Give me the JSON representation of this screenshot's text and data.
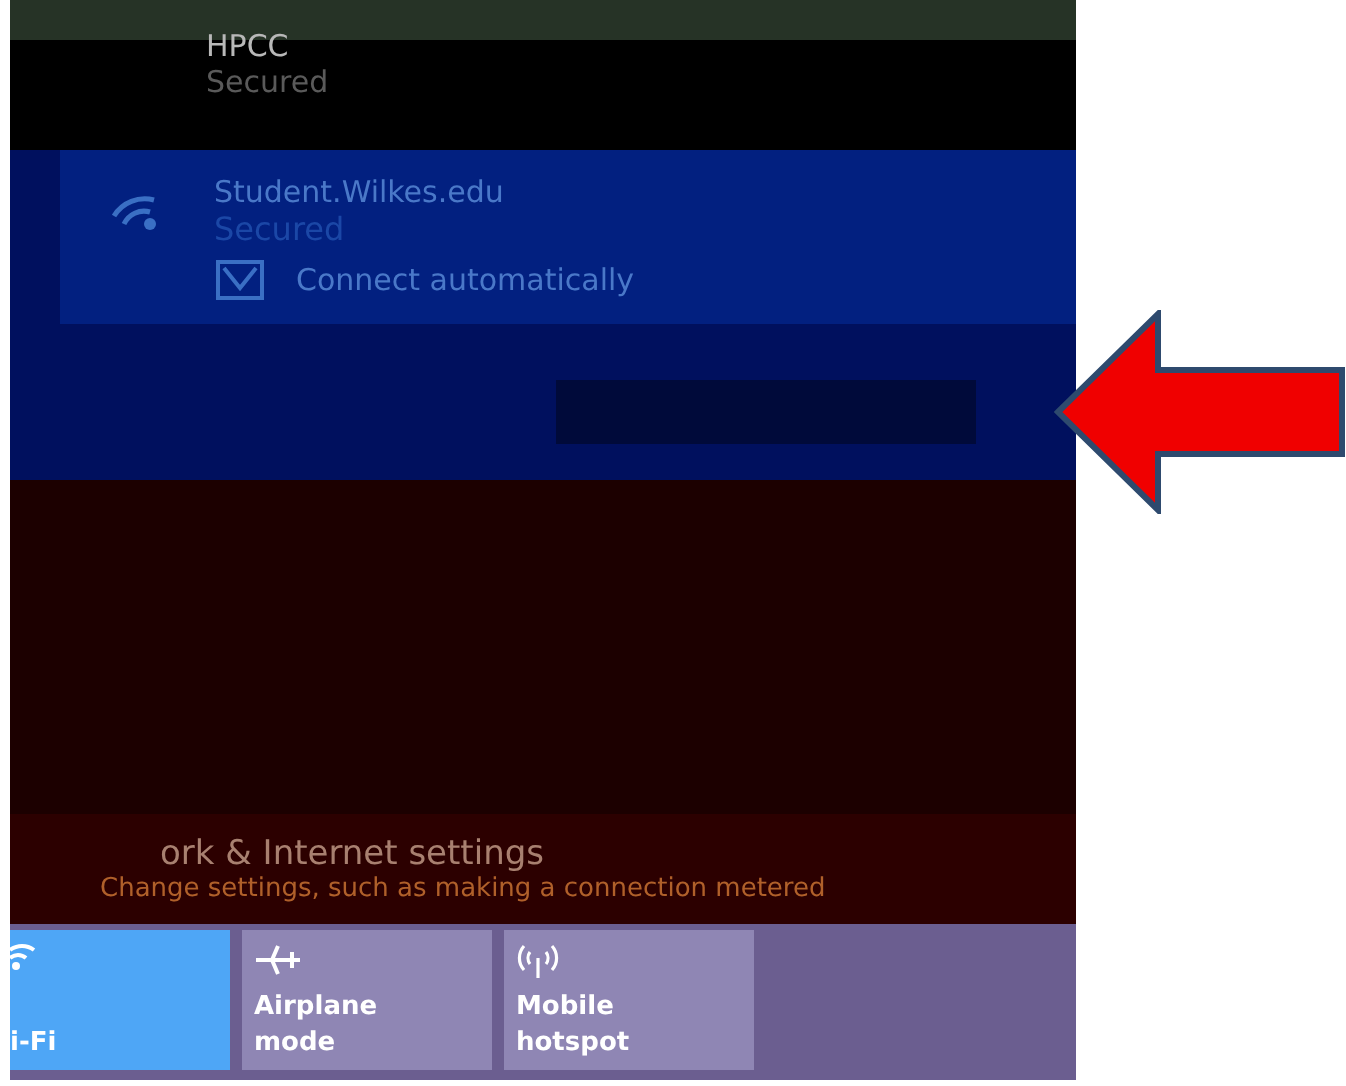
{
  "networks": [
    {
      "name": "HPCC",
      "status": "Secured"
    }
  ],
  "selected_network": {
    "name": "Student.Wilkes.edu",
    "status": "Secured",
    "connect_automatically": {
      "label": "Connect automatically",
      "checked": true
    }
  },
  "settings_link": {
    "title": "ork & Internet settings",
    "subtitle": "Change settings, such as making a connection metered"
  },
  "tiles": [
    {
      "label": "i-Fi",
      "kind": "wifi",
      "selected": true
    },
    {
      "label": "Airplane mode",
      "kind": "airplane",
      "selected": false
    },
    {
      "label": "Mobile hotspot",
      "kind": "hotspot",
      "selected": false
    }
  ]
}
